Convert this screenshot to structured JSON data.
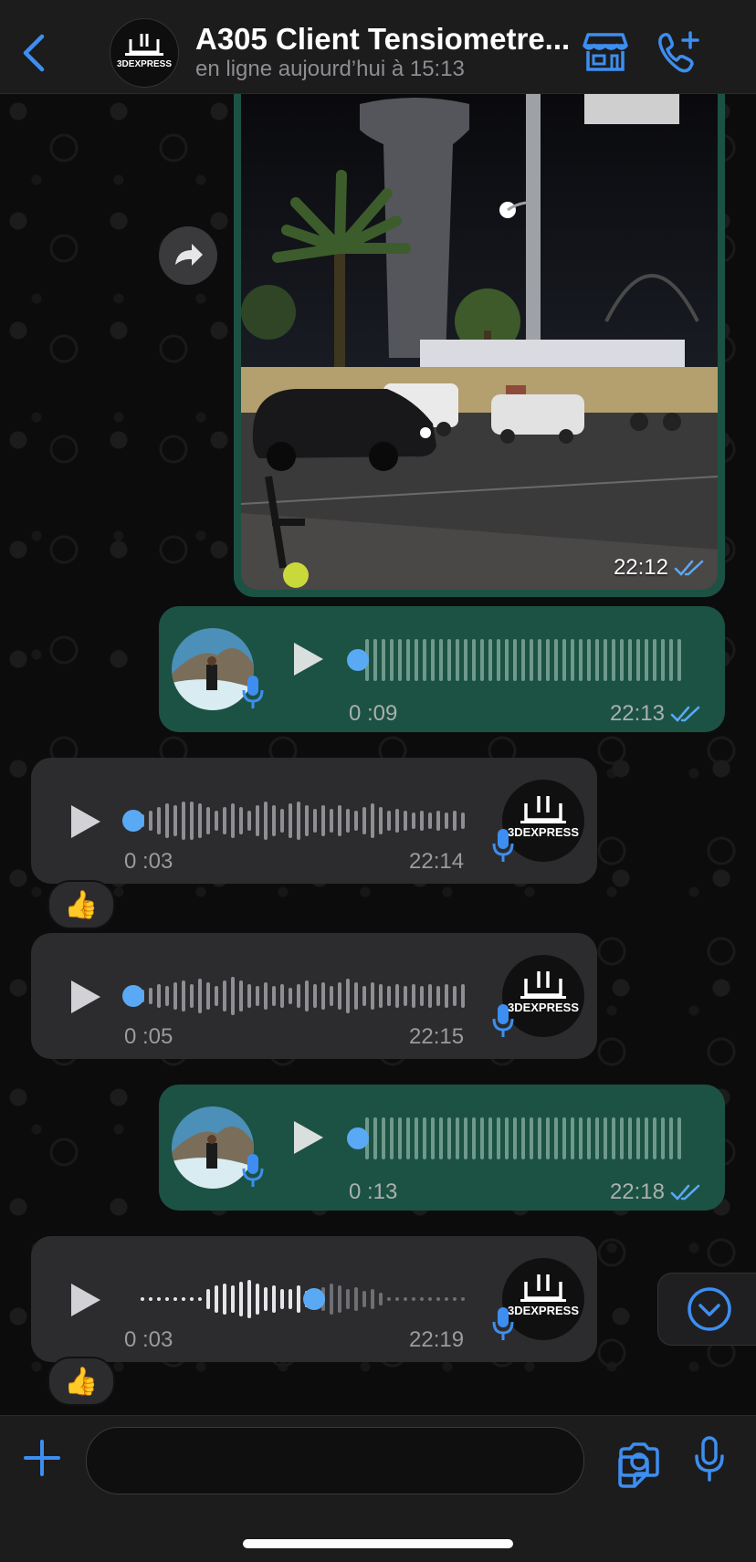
{
  "header": {
    "title": "A305 Client Tensiometre...",
    "status": "en ligne aujourd’hui à 15:13",
    "avatar_brand": "3DEXPRESS"
  },
  "messages": [
    {
      "type": "image",
      "direction": "outgoing",
      "time": "22:12",
      "read": true
    },
    {
      "type": "voice",
      "direction": "outgoing",
      "duration": "0 :09",
      "time": "22:13",
      "read": true
    },
    {
      "type": "voice",
      "direction": "incoming",
      "duration": "0 :03",
      "time": "22:14",
      "reaction": "👍"
    },
    {
      "type": "voice",
      "direction": "incoming",
      "duration": "0 :05",
      "time": "22:15"
    },
    {
      "type": "voice",
      "direction": "outgoing",
      "duration": "0 :13",
      "time": "22:18",
      "read": true
    },
    {
      "type": "voice",
      "direction": "incoming",
      "duration": "0 :03",
      "time": "22:19",
      "progress": 0.55,
      "reaction": "👍"
    }
  ],
  "colors": {
    "accent": "#3d8ef0",
    "outgoing_bubble": "#1c5243",
    "incoming_bubble": "#2c2c2e",
    "header": "#1c1c1d"
  },
  "icons": [
    "chevron-left-icon",
    "shop-icon",
    "add-call-icon",
    "forward-icon",
    "play-icon",
    "mic-icon",
    "double-check-icon",
    "thumbs-up-icon",
    "chevron-down-circle-icon",
    "plus-icon",
    "sticker-icon",
    "camera-icon",
    "microphone-icon"
  ]
}
